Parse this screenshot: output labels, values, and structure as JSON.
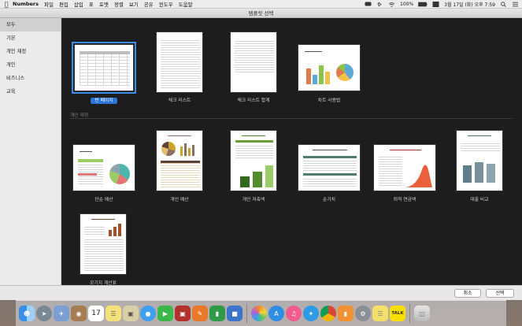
{
  "menubar": {
    "app_name": "Numbers",
    "items": [
      "파일",
      "편집",
      "삽입",
      "표",
      "포맷",
      "정렬",
      "보기",
      "공유",
      "윈도우",
      "도움말"
    ],
    "battery": "100%",
    "clock": "3월 17일 (화) 오후  7:59"
  },
  "window": {
    "title": "템플릿 선택"
  },
  "sidebar": {
    "items": [
      {
        "label": "모두",
        "selected": true
      },
      {
        "label": "기본",
        "selected": false
      },
      {
        "label": "개인 재정",
        "selected": false
      },
      {
        "label": "개인",
        "selected": false
      },
      {
        "label": "비즈니스",
        "selected": false
      },
      {
        "label": "교육",
        "selected": false
      }
    ]
  },
  "gallery": {
    "basic_templates": [
      {
        "label": "빈 페이지",
        "selected": true
      },
      {
        "label": "체크 리스트",
        "selected": false
      },
      {
        "label": "체크 리스트 합계",
        "selected": false
      },
      {
        "label": "차트 사용법",
        "selected": false
      }
    ],
    "section_title": "개인 재정",
    "finance_templates": [
      {
        "label": "단순 예산"
      },
      {
        "label": "개인 예산"
      },
      {
        "label": "개인 저축액"
      },
      {
        "label": "순가치"
      },
      {
        "label": "퇴직 연금액"
      },
      {
        "label": "대출 비교"
      },
      {
        "label": "모기지 계산표"
      }
    ]
  },
  "footer": {
    "cancel_label": "취소",
    "choose_label": "선택"
  },
  "dock": {
    "apps": [
      "finder-icon",
      "launchpad-icon",
      "photo-icon",
      "contacts-icon",
      "calendar-icon",
      "notes-icon",
      "preview-icon",
      "messages-icon",
      "facetime-icon",
      "photo-booth-icon",
      "pages-icon",
      "numbers-icon",
      "keynote-icon",
      "photos-icon",
      "app-store-icon",
      "itunes-icon",
      "safari-icon",
      "chrome-icon",
      "ibooks-icon",
      "system-preferences-icon",
      "stickies-icon",
      "kakaotalk-icon",
      "trash-icon"
    ],
    "calendar_day": "17",
    "kakaotalk_label": "TALK"
  }
}
